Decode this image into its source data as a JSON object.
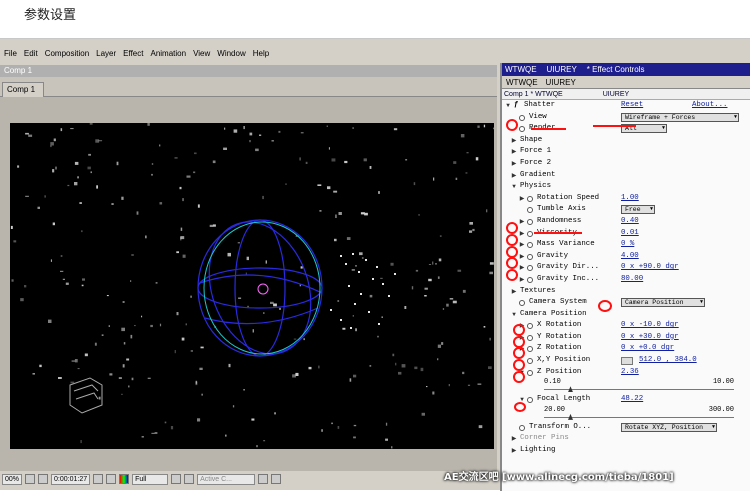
{
  "page_title": "参数设置",
  "menubar": [
    "File",
    "Edit",
    "Composition",
    "Layer",
    "Effect",
    "Animation",
    "View",
    "Window",
    "Help"
  ],
  "comp_window": {
    "title": "Comp 1",
    "tab": "Comp 1",
    "status": {
      "zoom": "00%",
      "timecode": "0:00:01:27",
      "resolution": "Full",
      "camera": "Active C..."
    }
  },
  "effect_panel": {
    "title_left": "WTWQE",
    "title_mid": "UIUREY",
    "title_right": "* Effect Controls",
    "tab_left": "WTWQE",
    "tab_mid": "UIUREY",
    "sub_left": "Comp 1 * WTWQE",
    "sub_right": "UIUREY",
    "effect_name": "Shatter",
    "reset": "Reset",
    "about": "About...",
    "rows": [
      {
        "label": "View",
        "dropdown": "Wireframe + Forces"
      },
      {
        "label": "Render",
        "dropdown": "All"
      },
      {
        "label": "Shape"
      },
      {
        "label": "Force 1"
      },
      {
        "label": "Force 2"
      },
      {
        "label": "Gradient"
      },
      {
        "label": "Physics"
      },
      {
        "label": "Rotation Speed",
        "value": "1.00"
      },
      {
        "label": "Tumble Axis",
        "dropdown": "Free"
      },
      {
        "label": "Randomness",
        "value": "0.40"
      },
      {
        "label": "Viscosity",
        "value": "0.01"
      },
      {
        "label": "Mass Variance",
        "value": "0 %"
      },
      {
        "label": "Gravity",
        "value": "4.00"
      },
      {
        "label": "Gravity Dir...",
        "value": "0 x +90.0 dgr"
      },
      {
        "label": "Gravity Inc...",
        "value": "80.00"
      },
      {
        "label": "Textures"
      },
      {
        "label": "Camera System",
        "dropdown": "Camera Position"
      },
      {
        "label": "Camera Position"
      },
      {
        "label": "X Rotation",
        "value": "0 x -10.0 dgr"
      },
      {
        "label": "Y Rotation",
        "value": "0 x +30.0 dgr"
      },
      {
        "label": "Z Rotation",
        "value": "0 x +0.0 dgr"
      },
      {
        "label": "X,Y Position",
        "value": "512.0 , 384.0"
      },
      {
        "label": "Z Position",
        "value": "2.36"
      },
      {
        "label": "Focal Length",
        "value": "48.22"
      },
      {
        "label": "Transform O...",
        "dropdown": "Rotate XYZ, Position"
      },
      {
        "label": "Corner Pins"
      },
      {
        "label": "Lighting"
      }
    ],
    "z_slider": {
      "min": "0.10",
      "max": "10.00"
    },
    "focal_slider": {
      "min": "20.00",
      "max": "300.00"
    }
  },
  "watermark": "AE交流区吧 [www.alinecg.com/tieba/1801]"
}
